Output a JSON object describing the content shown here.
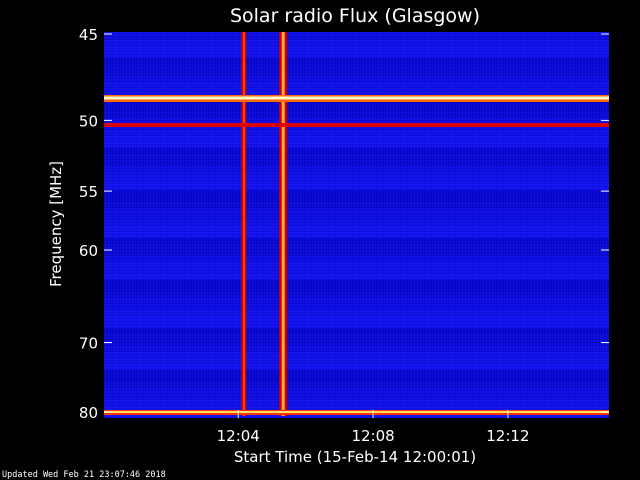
{
  "chart_data": {
    "type": "heatmap",
    "title": "Solar radio Flux (Glasgow)",
    "ylabel": "Frequency [MHz]",
    "xlabel": "Start Time (15-Feb-14 12:00:01)",
    "y_scale": "reciprocal",
    "ylim": [
      45,
      80
    ],
    "y_ticks": [
      "45",
      "50",
      "55",
      "60",
      "70",
      "80"
    ],
    "xlim": [
      "12:00:01",
      "12:15:00"
    ],
    "x_ticks": [
      "12:04",
      "12:08",
      "12:12"
    ],
    "grid": false,
    "colormap": [
      "#00007f",
      "#0000cc",
      "#2a2aff",
      "#cc0000",
      "#ff4400",
      "#ffff66",
      "#ffffff"
    ],
    "features": [
      {
        "kind": "broadband-burst",
        "time": "12:05:20",
        "freq_range": [
          45,
          80
        ]
      },
      {
        "kind": "broadband-burst",
        "time": "12:04:10",
        "freq_range": [
          45,
          80
        ]
      },
      {
        "kind": "interference-band",
        "freq": 48.6
      },
      {
        "kind": "interference-band",
        "freq": 50.3
      },
      {
        "kind": "interference-band",
        "freq": 80
      }
    ]
  },
  "footer": "Updated Wed Feb 21 23:07:46 2018"
}
